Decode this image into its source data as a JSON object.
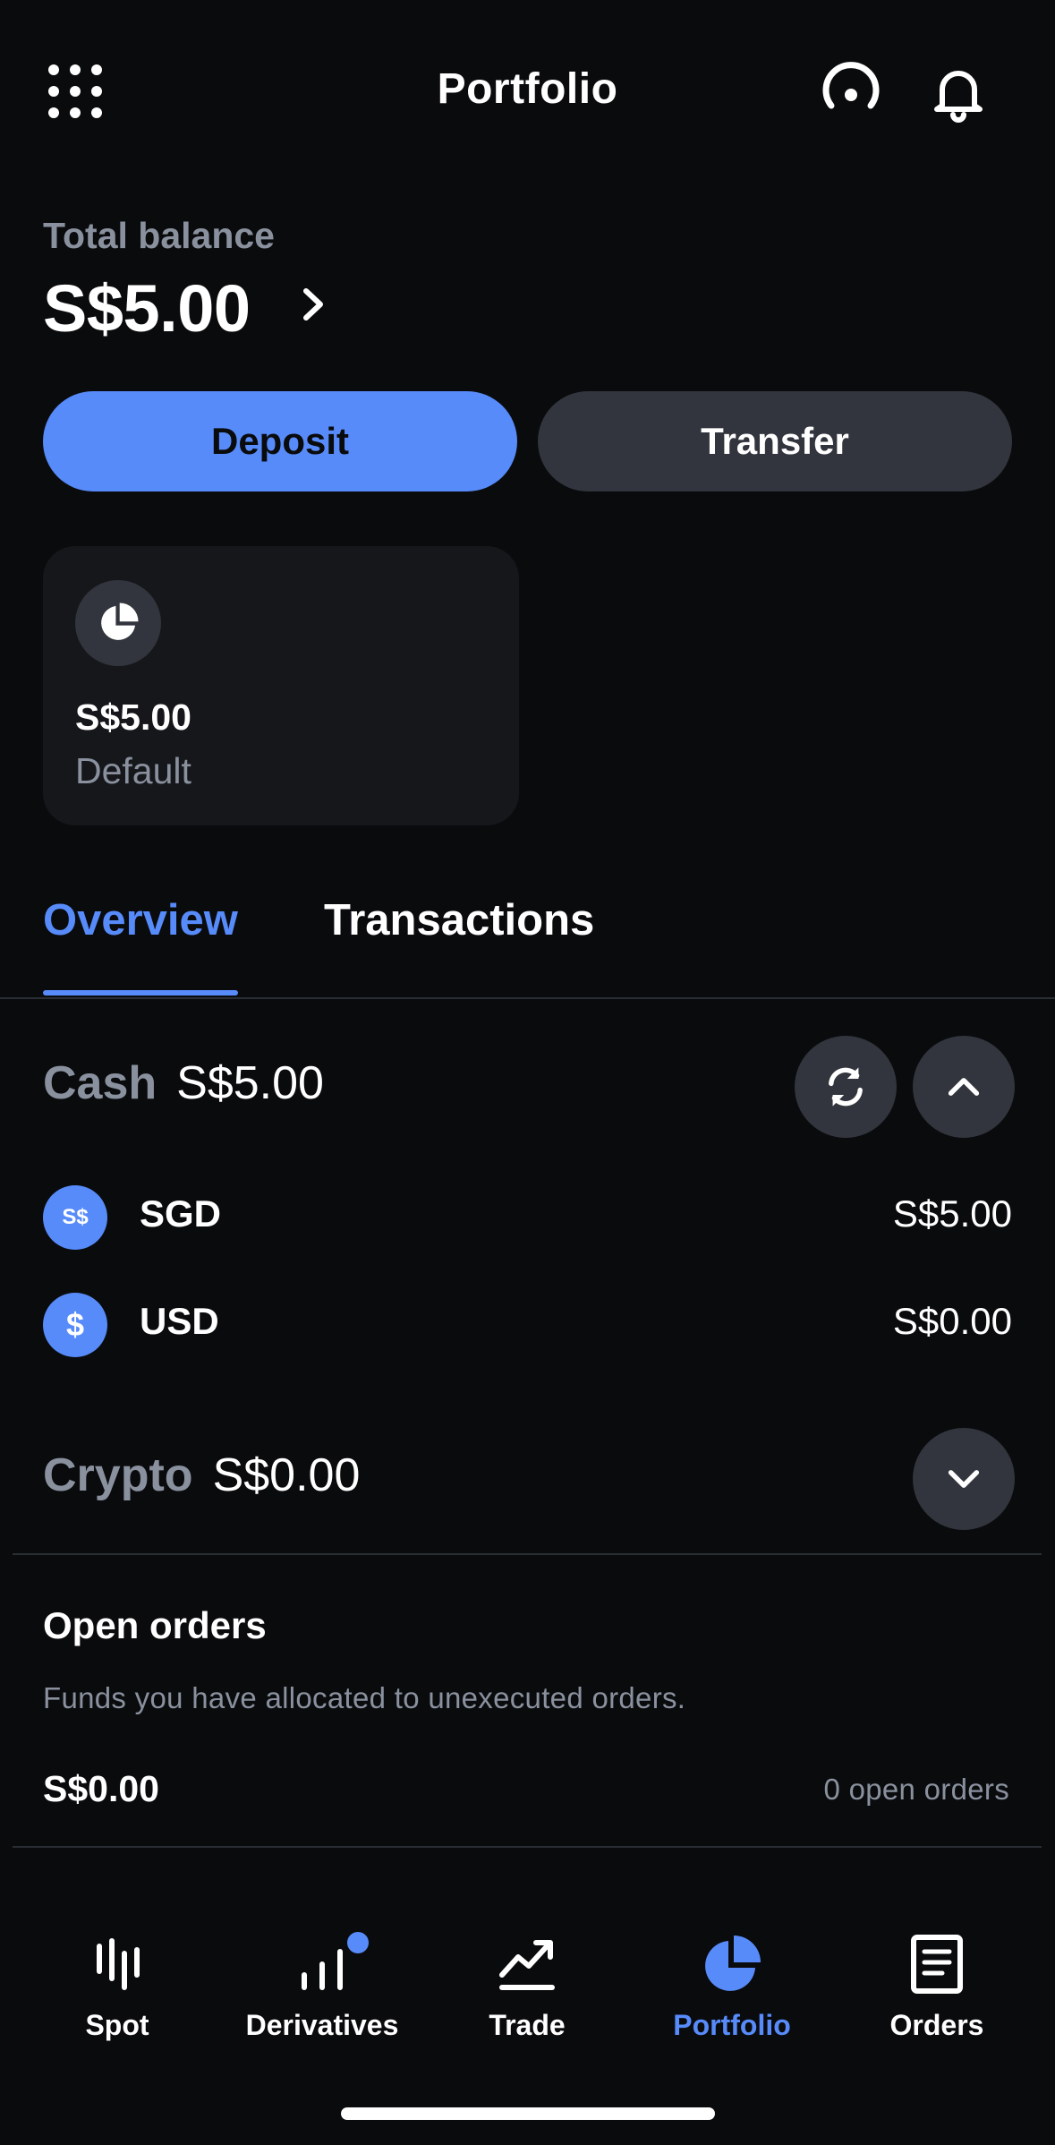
{
  "header": {
    "title": "Portfolio",
    "menu_icon": "grid-icon",
    "support_icon": "support-icon",
    "notifications_icon": "bell-icon"
  },
  "balance": {
    "label": "Total balance",
    "value": "S$5.00"
  },
  "actions": {
    "deposit_label": "Deposit",
    "transfer_label": "Transfer"
  },
  "account_card": {
    "amount": "S$5.00",
    "label": "Default"
  },
  "tabs": [
    {
      "label": "Overview",
      "active": true
    },
    {
      "label": "Transactions",
      "active": false
    }
  ],
  "cash": {
    "label": "Cash",
    "value": "S$5.00",
    "items": [
      {
        "symbol": "S$",
        "name": "SGD",
        "amount": "S$5.00"
      },
      {
        "symbol": "$",
        "name": "USD",
        "amount": "S$0.00"
      }
    ]
  },
  "crypto": {
    "label": "Crypto",
    "value": "S$0.00"
  },
  "open_orders": {
    "title": "Open orders",
    "description": "Funds you have allocated to unexecuted orders.",
    "amount": "S$0.00",
    "count_text": "0 open orders"
  },
  "bottom_nav": [
    {
      "label": "Spot",
      "icon": "spot-icon",
      "active": false
    },
    {
      "label": "Derivatives",
      "icon": "derivatives-icon",
      "active": false,
      "badge": true
    },
    {
      "label": "Trade",
      "icon": "trade-icon",
      "active": false
    },
    {
      "label": "Portfolio",
      "icon": "portfolio-icon",
      "active": true
    },
    {
      "label": "Orders",
      "icon": "orders-icon",
      "active": false
    }
  ],
  "colors": {
    "accent": "#578bfa",
    "background": "#0a0b0d",
    "surface": "#16171b",
    "button_secondary": "#32353d",
    "muted_text": "#8a919e"
  }
}
